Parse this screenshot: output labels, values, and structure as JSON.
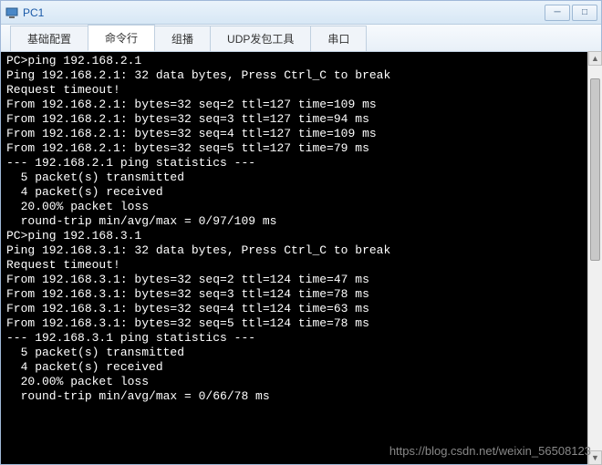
{
  "window": {
    "title": "PC1"
  },
  "tabs": [
    {
      "id": "basic",
      "label": "基础配置",
      "active": false
    },
    {
      "id": "cmdline",
      "label": "命令行",
      "active": true
    },
    {
      "id": "multicast",
      "label": "组播",
      "active": false
    },
    {
      "id": "udp",
      "label": "UDP发包工具",
      "active": false
    },
    {
      "id": "serial",
      "label": "串口",
      "active": false
    }
  ],
  "terminal_lines": [
    "PC>ping 192.168.2.1",
    "",
    "Ping 192.168.2.1: 32 data bytes, Press Ctrl_C to break",
    "Request timeout!",
    "From 192.168.2.1: bytes=32 seq=2 ttl=127 time=109 ms",
    "From 192.168.2.1: bytes=32 seq=3 ttl=127 time=94 ms",
    "From 192.168.2.1: bytes=32 seq=4 ttl=127 time=109 ms",
    "From 192.168.2.1: bytes=32 seq=5 ttl=127 time=79 ms",
    "",
    "--- 192.168.2.1 ping statistics ---",
    "  5 packet(s) transmitted",
    "  4 packet(s) received",
    "  20.00% packet loss",
    "  round-trip min/avg/max = 0/97/109 ms",
    "",
    "PC>ping 192.168.3.1",
    "",
    "Ping 192.168.3.1: 32 data bytes, Press Ctrl_C to break",
    "Request timeout!",
    "From 192.168.3.1: bytes=32 seq=2 ttl=124 time=47 ms",
    "From 192.168.3.1: bytes=32 seq=3 ttl=124 time=78 ms",
    "From 192.168.3.1: bytes=32 seq=4 ttl=124 time=63 ms",
    "From 192.168.3.1: bytes=32 seq=5 ttl=124 time=78 ms",
    "",
    "--- 192.168.3.1 ping statistics ---",
    "  5 packet(s) transmitted",
    "  4 packet(s) received",
    "  20.00% packet loss",
    "  round-trip min/avg/max = 0/66/78 ms"
  ],
  "watermark": "https://blog.csdn.net/weixin_56508123",
  "colors": {
    "titlebar_text": "#1a5aa8",
    "terminal_bg": "#000000",
    "terminal_fg": "#ffffff"
  }
}
